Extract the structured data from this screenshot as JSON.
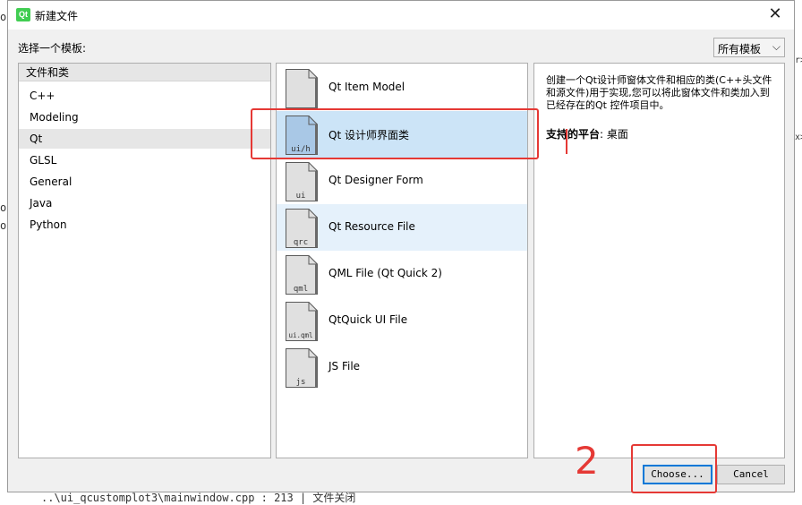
{
  "background": {
    "fragments": [
      "or",
      "op",
      "op",
      "r>",
      "x>",
      "..\\ui_qcustomplot3\\mainwindow.cpp : 213  |  文件关闭"
    ]
  },
  "dialog": {
    "title": "新建文件",
    "close_glyph": "✕",
    "choose_label": "选择一个模板:",
    "filter": {
      "value": "所有模板",
      "chevron": "⌵"
    },
    "categories": {
      "header": "文件和类",
      "items": [
        "C++",
        "Modeling",
        "Qt",
        "GLSL",
        "General",
        "Java",
        "Python"
      ],
      "selected_index": 2
    },
    "templates": [
      {
        "label": "Qt Item Model",
        "icon_text": "",
        "icon": "file-icon"
      },
      {
        "label": "Qt 设计师界面类",
        "icon_text": "ui/h",
        "icon": "file-icon",
        "selected": true
      },
      {
        "label": "Qt Designer Form",
        "icon_text": "ui",
        "icon": "file-icon"
      },
      {
        "label": "Qt Resource File",
        "icon_text": "qrc",
        "icon": "file-icon",
        "hover": true
      },
      {
        "label": "QML File (Qt Quick 2)",
        "icon_text": "qml",
        "icon": "file-icon"
      },
      {
        "label": "QtQuick UI File",
        "icon_text": "ui.qml",
        "icon": "file-icon"
      },
      {
        "label": "JS File",
        "icon_text": "js",
        "icon": "file-icon"
      }
    ],
    "description": {
      "text": "创建一个Qt设计师窗体文件和相应的类(C++头文件和源文件)用于实现,您可以将此窗体文件和类加入到已经存在的Qt 控件项目中。",
      "platform_label": "支持的平台",
      "platform_value": ": 桌面"
    },
    "buttons": {
      "choose": "Choose...",
      "cancel": "Cancel"
    }
  },
  "annotations": {
    "number_two": "2",
    "color": "#e53935"
  },
  "colors": {
    "selection": "#cce4f7",
    "hover": "#e5f1fb",
    "qt_green": "#41cd52",
    "default_button_border": "#0078d7"
  }
}
